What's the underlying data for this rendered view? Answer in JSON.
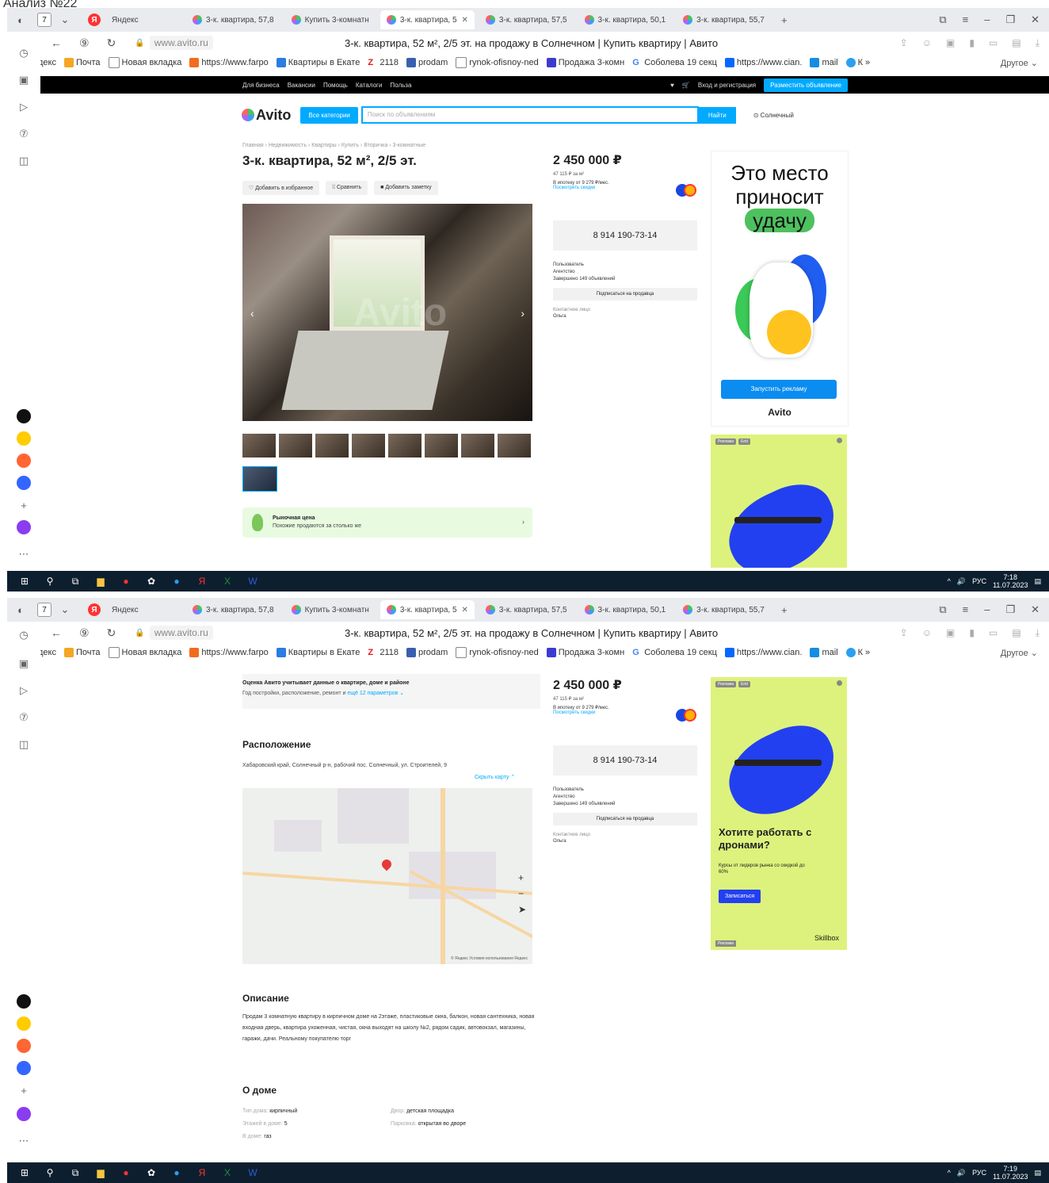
{
  "caption": "Анализ №22",
  "browser": {
    "tab_count": "7",
    "first_tab": "Яндекс",
    "tabs": [
      {
        "label": "3-к. квартира, 57,8",
        "active": false
      },
      {
        "label": "Купить 3-комнатн",
        "active": false
      },
      {
        "label": "3-к. квартира, 5",
        "active": true
      },
      {
        "label": "3-к. квартира, 57,5",
        "active": false
      },
      {
        "label": "3-к. квартира, 50,1",
        "active": false
      },
      {
        "label": "3-к. квартира, 55,7",
        "active": false
      }
    ],
    "url": "www.avito.ru",
    "page_title": "3-к. квартира, 52 м², 2/5 эт. на продажу в Солнечном | Купить квартиру | Авито",
    "bookmarks": [
      {
        "label": "Яндекс",
        "color": "#111111"
      },
      {
        "label": "Почта",
        "color": "#f5a623"
      },
      {
        "label": "Новая вкладка",
        "color": "#ffffff"
      },
      {
        "label": "https://www.farpo",
        "color": "#f26b1d"
      },
      {
        "label": "Квартиры в Екате",
        "color": "#2a7de1"
      },
      {
        "label": "2118",
        "color": "#e11"
      },
      {
        "label": "prodam",
        "color": "#3a5fb0"
      },
      {
        "label": "rynok-ofisnoy-ned",
        "color": "#ffffff"
      },
      {
        "label": "Продажа 3-комн",
        "color": "#3b3bd0"
      },
      {
        "label": "Соболева 19 секц",
        "color": "#4285f4"
      },
      {
        "label": "https://www.cian.",
        "color": "#0468ff"
      },
      {
        "label": "mail",
        "color": "#168de2"
      },
      {
        "label": "К",
        "color": "#2aa0f0"
      }
    ],
    "bookmarks_other": "Другое"
  },
  "avito": {
    "top_links": [
      "Для бизнеса",
      "Вакансии",
      "Помощь",
      "Каталоги",
      "Польза"
    ],
    "login": "Вход и регистрация",
    "post_ad": "Разместить объявление",
    "logo": "Avito",
    "all_categories": "Все категории",
    "search_placeholder": "Поиск по объявлениям",
    "search_button": "Найти",
    "location": "Солнечный",
    "breadcrumbs": "Главная › Недвижимость › Квартиры › Купить › Вторичка › 3-комнатные",
    "title": "3-к. квартира, 52 м², 2/5 эт.",
    "action_fav": "♡ Добавить в избранное",
    "action_compare": "Сравнить",
    "action_note": "Добавить заметку",
    "watermark": "Avito",
    "market_title": "Рыночная цена",
    "market_sub": "Похожие продаются за столько же",
    "price": "2 450 000 ₽",
    "price_per_m": "47 115 ₽ за м²",
    "mortgage": "В ипотеку от 9 279 ₽/мес.",
    "mortgage_link": "Посмотреть скидки",
    "phone": "8 914 190-73-14",
    "seller_type": "Пользователь",
    "seller_name": "Агентство",
    "seller_done": "Завершено 149 объявлений",
    "subscribe": "Подписаться на продавца",
    "contact_label": "Контактное лицо",
    "contact_name": "Ольга",
    "estimate_title": "Оценка Авито учитывает данные о квартире, доме и районе",
    "estimate_sub": "Год постройки, расположение, ремонт и",
    "estimate_link": "ещё 12 параметров ⌄",
    "location_title": "Расположение",
    "address": "Хабаровский край, Солнечный р-н, рабочий пос. Солнечный, ул. Строителей, 9",
    "hide_map": "Скрыть карту ⌃",
    "map_copyright": "© Яндекс Условия использования Яндекс",
    "description_title": "Описание",
    "description": "Продам 3 комнатную квартиру в кирпичном доме на 2этаже, пластиковые окна, балкон, новая сантехника, новая входная дверь, квартира ухоженная, чистая, окна выходят на школу №2, рядом садик, автовокзал, магазины, гаражи, дачи. Реальному покупателю торг",
    "house_title": "О доме",
    "house": [
      {
        "k": "Тип дома:",
        "v": "кирпичный"
      },
      {
        "k": "Этажей в доме:",
        "v": "5"
      },
      {
        "k": "В доме:",
        "v": "газ"
      }
    ],
    "house2": [
      {
        "k": "Двор:",
        "v": "детская площадка"
      },
      {
        "k": "Парковка:",
        "v": "открытая во дворе"
      }
    ]
  },
  "ads": {
    "ad1_line1": "Это место",
    "ad1_line2": "приносит",
    "ad1_line3": "удачу",
    "ad1_cta": "Запустить рекламу",
    "ad1_logo": "Avito",
    "ad2_tag1": "Реклама",
    "ad2_tag2": "Erid",
    "ad2_title": "Хотите работать с дронами?",
    "ad2_sub": "Курсы от лидеров рынка со скидкой до 60%",
    "ad2_cta": "Записаться",
    "ad2_brand": "Skillbox",
    "ad2_label": "Реклама"
  },
  "taskbar": {
    "lang": "РУС",
    "time1": "7:18",
    "date1": "11.07.2023",
    "time2": "7:19",
    "date2": "11.07.2023"
  }
}
